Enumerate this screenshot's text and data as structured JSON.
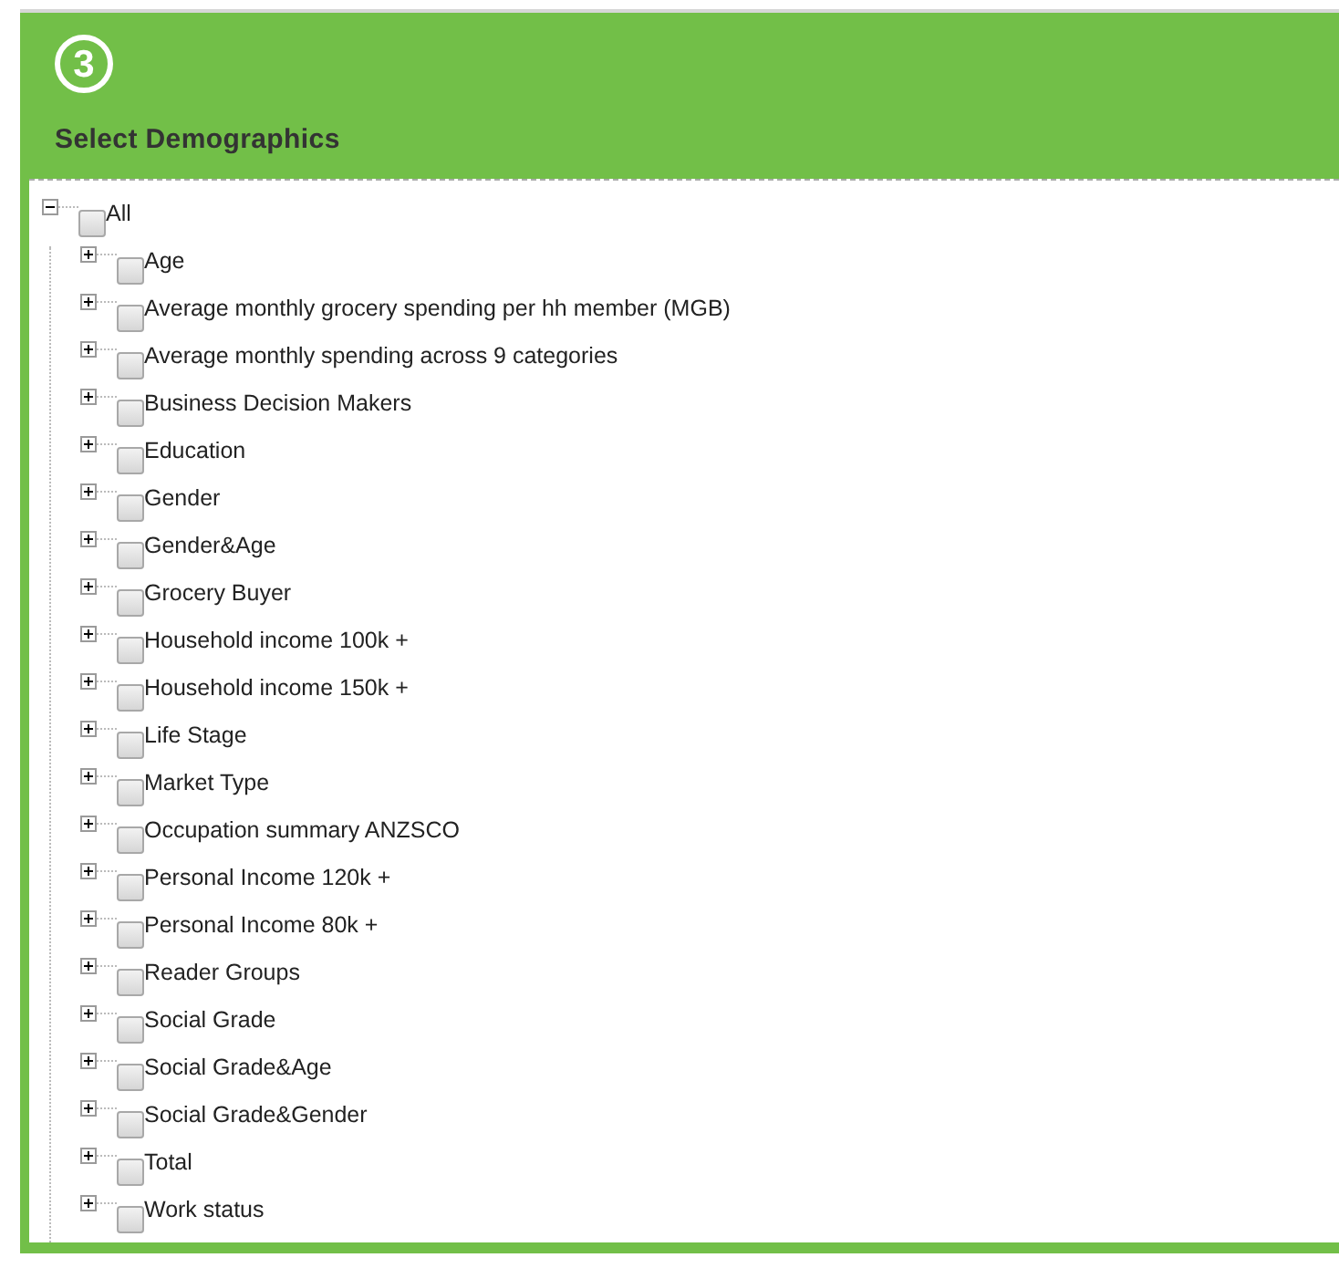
{
  "step": "3",
  "title": "Select Demographics",
  "tree": {
    "label": "All",
    "expanded": true,
    "checked": false,
    "children": [
      {
        "label": "Age",
        "expanded": false,
        "checked": false
      },
      {
        "label": "Average monthly grocery spending per hh member (MGB)",
        "expanded": false,
        "checked": false
      },
      {
        "label": "Average monthly spending across 9 categories",
        "expanded": false,
        "checked": false
      },
      {
        "label": "Business Decision Makers",
        "expanded": false,
        "checked": false
      },
      {
        "label": "Education",
        "expanded": false,
        "checked": false
      },
      {
        "label": "Gender",
        "expanded": false,
        "checked": false
      },
      {
        "label": "Gender&Age",
        "expanded": false,
        "checked": false
      },
      {
        "label": "Grocery Buyer",
        "expanded": false,
        "checked": false
      },
      {
        "label": "Household income 100k +",
        "expanded": false,
        "checked": false
      },
      {
        "label": "Household income 150k +",
        "expanded": false,
        "checked": false
      },
      {
        "label": "Life Stage",
        "expanded": false,
        "checked": false
      },
      {
        "label": "Market Type",
        "expanded": false,
        "checked": false
      },
      {
        "label": "Occupation summary ANZSCO",
        "expanded": false,
        "checked": false
      },
      {
        "label": "Personal Income 120k +",
        "expanded": false,
        "checked": false
      },
      {
        "label": "Personal Income 80k +",
        "expanded": false,
        "checked": false
      },
      {
        "label": "Reader Groups",
        "expanded": false,
        "checked": false
      },
      {
        "label": "Social Grade",
        "expanded": false,
        "checked": false
      },
      {
        "label": "Social Grade&Age",
        "expanded": false,
        "checked": false
      },
      {
        "label": "Social Grade&Gender",
        "expanded": false,
        "checked": false
      },
      {
        "label": "Total",
        "expanded": false,
        "checked": false
      },
      {
        "label": "Work status",
        "expanded": false,
        "checked": false
      }
    ]
  }
}
